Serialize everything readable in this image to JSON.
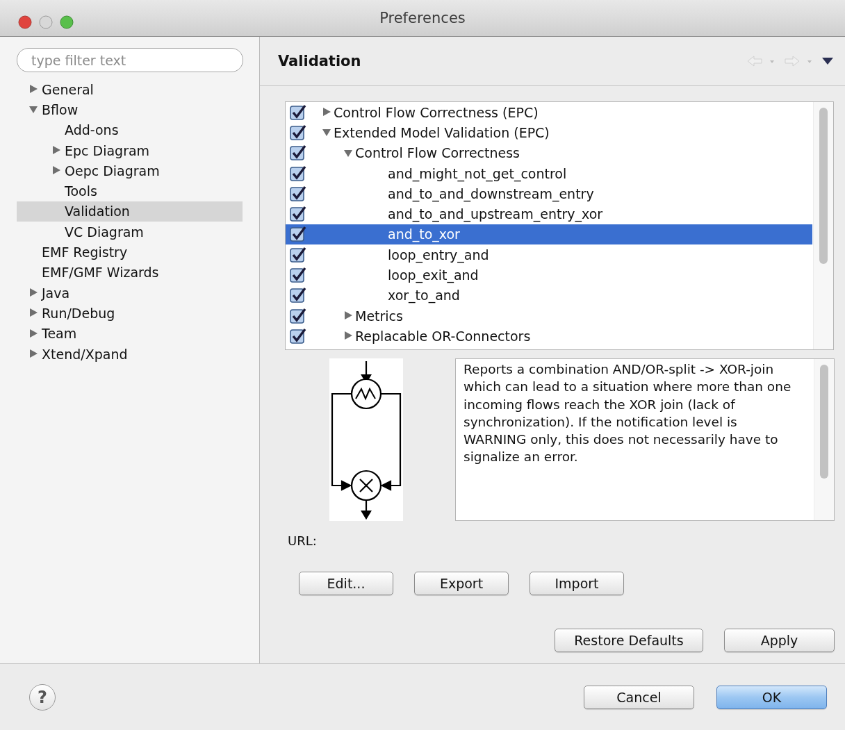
{
  "window": {
    "title": "Preferences"
  },
  "sidebar": {
    "filter": {
      "placeholder": "type filter text"
    },
    "items": [
      {
        "label": "General",
        "expanded": false,
        "selected": false
      },
      {
        "label": "Bflow",
        "expanded": true,
        "selected": false,
        "children": [
          {
            "label": "Add-ons",
            "selected": false
          },
          {
            "label": "Epc Diagram",
            "expanded": false,
            "selected": false
          },
          {
            "label": "Oepc Diagram",
            "expanded": false,
            "selected": false
          },
          {
            "label": "Tools",
            "selected": false
          },
          {
            "label": "Validation",
            "selected": true
          },
          {
            "label": "VC Diagram",
            "selected": false
          }
        ]
      },
      {
        "label": "EMF Registry",
        "selected": false
      },
      {
        "label": "EMF/GMF Wizards",
        "selected": false
      },
      {
        "label": "Java",
        "expanded": false,
        "selected": false
      },
      {
        "label": "Run/Debug",
        "expanded": false,
        "selected": false
      },
      {
        "label": "Team",
        "expanded": false,
        "selected": false
      },
      {
        "label": "Xtend/Xpand",
        "expanded": false,
        "selected": false
      }
    ]
  },
  "page": {
    "title": "Validation"
  },
  "rules": [
    {
      "label": "Control Flow Correctness (EPC)",
      "checked": true,
      "expanded": false,
      "selected": false
    },
    {
      "label": "Extended Model Validation (EPC)",
      "checked": true,
      "expanded": true,
      "selected": false,
      "children": [
        {
          "label": "Control Flow Correctness",
          "checked": true,
          "expanded": true,
          "selected": false,
          "children": [
            {
              "label": "and_might_not_get_control",
              "checked": true,
              "selected": false
            },
            {
              "label": "and_to_and_downstream_entry",
              "checked": true,
              "selected": false
            },
            {
              "label": "and_to_and_upstream_entry_xor",
              "checked": true,
              "selected": false
            },
            {
              "label": "and_to_xor",
              "checked": true,
              "selected": true
            },
            {
              "label": "loop_entry_and",
              "checked": true,
              "selected": false
            },
            {
              "label": "loop_exit_and",
              "checked": true,
              "selected": false
            },
            {
              "label": "xor_to_and",
              "checked": true,
              "selected": false
            }
          ]
        },
        {
          "label": "Metrics",
          "checked": true,
          "expanded": false,
          "selected": false
        },
        {
          "label": "Replacable OR-Connectors",
          "checked": true,
          "expanded": false,
          "selected": false
        }
      ]
    }
  ],
  "description": "Reports a combination AND/OR-split -> XOR-join which can lead to a situation where more than one incoming flows reach the XOR join (lack of synchronization). If the notification level is WARNING only, this does not necessarily have to signalize an error.",
  "url_label": "URL:",
  "rule_buttons": [
    "Edit...",
    "Export",
    "Import"
  ],
  "page_buttons": [
    "Restore Defaults",
    "Apply"
  ],
  "footer": {
    "help": "?",
    "buttons": [
      {
        "label": "Cancel",
        "default": false
      },
      {
        "label": "OK",
        "default": true
      }
    ]
  }
}
